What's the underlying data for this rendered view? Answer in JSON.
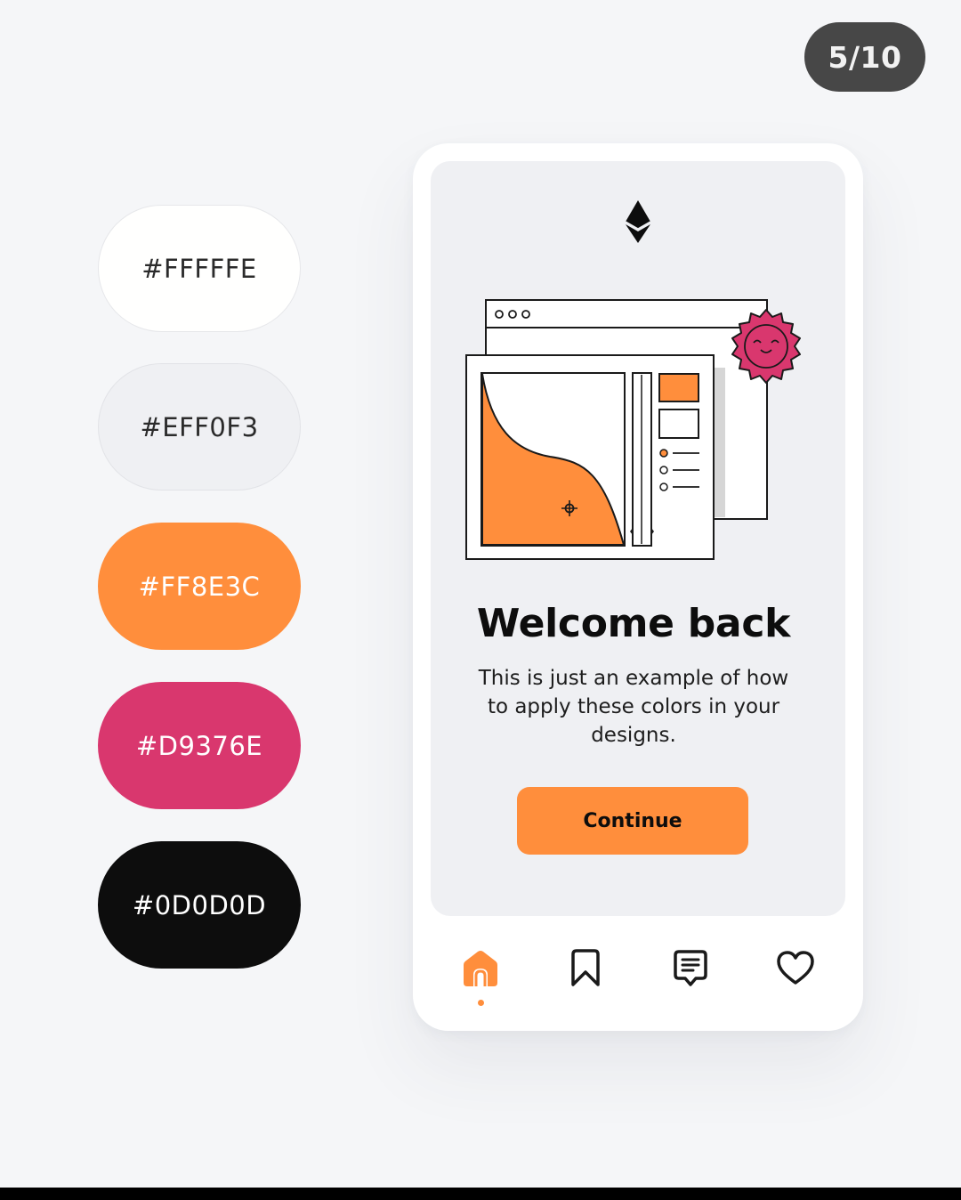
{
  "page_counter": "5/10",
  "swatches": [
    {
      "label": "#FFFFFE",
      "bg": "#FFFFFE",
      "fg": "#2b2b2b",
      "border": "#e6e7ea"
    },
    {
      "label": "#EFF0F3",
      "bg": "#EFF0F3",
      "fg": "#2b2b2b",
      "border": "#e2e3e7"
    },
    {
      "label": "#FF8E3C",
      "bg": "#FF8E3C",
      "fg": "#ffffff",
      "border": "#FF8E3C"
    },
    {
      "label": "#D9376E",
      "bg": "#D9376E",
      "fg": "#ffffff",
      "border": "#D9376E"
    },
    {
      "label": "#0D0D0D",
      "bg": "#0D0D0D",
      "fg": "#ffffff",
      "border": "#0D0D0D"
    }
  ],
  "phone": {
    "logo_icon": "ethereum-icon",
    "title": "Welcome back",
    "body": "This is just an example of how to apply these colors in your designs.",
    "button_label": "Continue",
    "nav": [
      {
        "name": "home-icon",
        "active": true
      },
      {
        "name": "bookmark-icon",
        "active": false
      },
      {
        "name": "message-icon",
        "active": false
      },
      {
        "name": "heart-icon",
        "active": false
      }
    ]
  },
  "colors": {
    "background": "#EFF0F3",
    "accent": "#FF8E3C",
    "secondary": "#D9376E",
    "text": "#0D0D0D",
    "surface": "#FFFFFE"
  }
}
